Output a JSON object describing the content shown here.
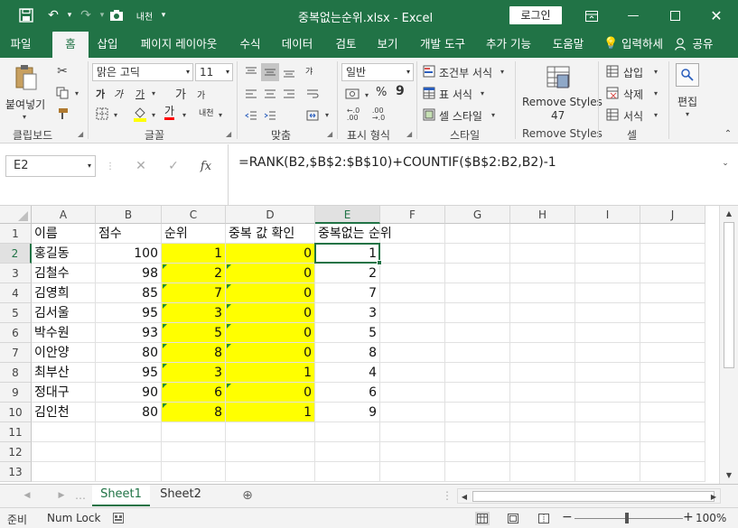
{
  "title_bar": {
    "title": "중복없는순위.xlsx  -  Excel",
    "login": "로그인"
  },
  "ribbon_tabs": [
    "파일",
    "홈",
    "삽입",
    "페이지 레이아웃",
    "수식",
    "데이터",
    "검토",
    "보기",
    "개발 도구",
    "추가 기능",
    "도움말",
    "입력하세",
    "공유"
  ],
  "active_tab": "홈",
  "ribbon": {
    "clipboard": {
      "paste": "붙여넣기",
      "label": "클립보드"
    },
    "font": {
      "name": "맑은 고딕",
      "size": "11",
      "label": "글꼴",
      "bold": "가",
      "italic": "가",
      "underline": "가",
      "grow": "가",
      "shrink": "가",
      "color": "가",
      "phonetic": "내천"
    },
    "alignment": {
      "label": "맞춤",
      "wrap": "갸"
    },
    "number": {
      "format": "일반",
      "label": "표시 형식",
      "percent": "%",
      "comma": "9"
    },
    "styles": {
      "conditional": "조건부 서식",
      "table": "표 서식",
      "cell": "셀 스타일",
      "label": "스타일"
    },
    "remove_styles": {
      "line1": "Remove Styles",
      "line2": "47",
      "label": "Remove Styles"
    },
    "cells": {
      "insert": "삽입",
      "delete": "삭제",
      "format": "서식",
      "label": "셀"
    },
    "editing": {
      "label": "편집"
    }
  },
  "formula_bar": {
    "name_box": "E2",
    "formula": "=RANK(B2,$B$2:$B$10)+COUNTIF($B$2:B2,B2)-1"
  },
  "columns": [
    "A",
    "B",
    "C",
    "D",
    "E",
    "F",
    "G",
    "H",
    "I",
    "J"
  ],
  "rows": [
    "1",
    "2",
    "3",
    "4",
    "5",
    "6",
    "7",
    "8",
    "9",
    "10",
    "11",
    "12",
    "13"
  ],
  "header_row": [
    "이름",
    "점수",
    "순위",
    "중복 값 확인",
    "중복없는 순위"
  ],
  "data_rows": [
    [
      "홍길동",
      "100",
      "1",
      "0",
      "1"
    ],
    [
      "김철수",
      "98",
      "2",
      "0",
      "2"
    ],
    [
      "김영희",
      "85",
      "7",
      "0",
      "7"
    ],
    [
      "김서울",
      "95",
      "3",
      "0",
      "3"
    ],
    [
      "박수원",
      "93",
      "5",
      "0",
      "5"
    ],
    [
      "이안양",
      "80",
      "8",
      "0",
      "8"
    ],
    [
      "최부산",
      "95",
      "3",
      "1",
      "4"
    ],
    [
      "정대구",
      "90",
      "6",
      "0",
      "6"
    ],
    [
      "김인천",
      "80",
      "8",
      "1",
      "9"
    ]
  ],
  "sheet_tabs": [
    "Sheet1",
    "Sheet2"
  ],
  "active_sheet": "Sheet1",
  "status_bar": {
    "ready": "준비",
    "numlock": "Num Lock",
    "zoom": "100%"
  },
  "colors": {
    "brand": "#217346",
    "highlight": "#ffff00"
  }
}
